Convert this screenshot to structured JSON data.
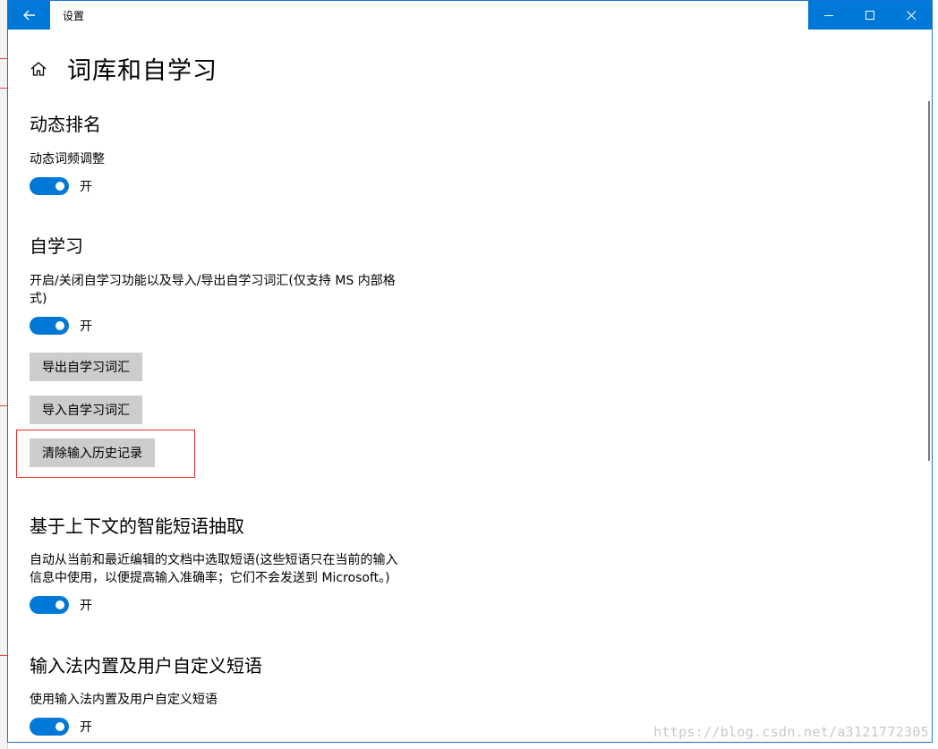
{
  "window": {
    "title": "设置"
  },
  "page": {
    "title": "词库和自学习"
  },
  "sections": {
    "dynamic": {
      "title": "动态排名",
      "label": "动态词频调整",
      "toggle_state": "开"
    },
    "selflearn": {
      "title": "自学习",
      "label_line1": "开启/关闭自学习功能以及导入/导出自学习词汇(仅支持 MS 内部格",
      "label_line2": "式)",
      "toggle_state": "开",
      "export_button": "导出自学习词汇",
      "import_button": "导入自学习词汇",
      "clear_button": "清除输入历史记录"
    },
    "context": {
      "title": "基于上下文的智能短语抽取",
      "label_line1": "自动从当前和最近编辑的文档中选取短语(这些短语只在当前的输入",
      "label_line2": "信息中使用，以便提高输入准确率；它们不会发送到 Microsoft。)",
      "toggle_state": "开"
    },
    "phrases": {
      "title": "输入法内置及用户自定义短语",
      "label": "使用输入法内置及用户自定义短语",
      "toggle_state": "开"
    }
  },
  "watermark": "https://blog.csdn.net/a3121772305",
  "colors": {
    "accent": "#0078d7",
    "button_bg": "#cccccc",
    "highlight": "#e0302a"
  }
}
